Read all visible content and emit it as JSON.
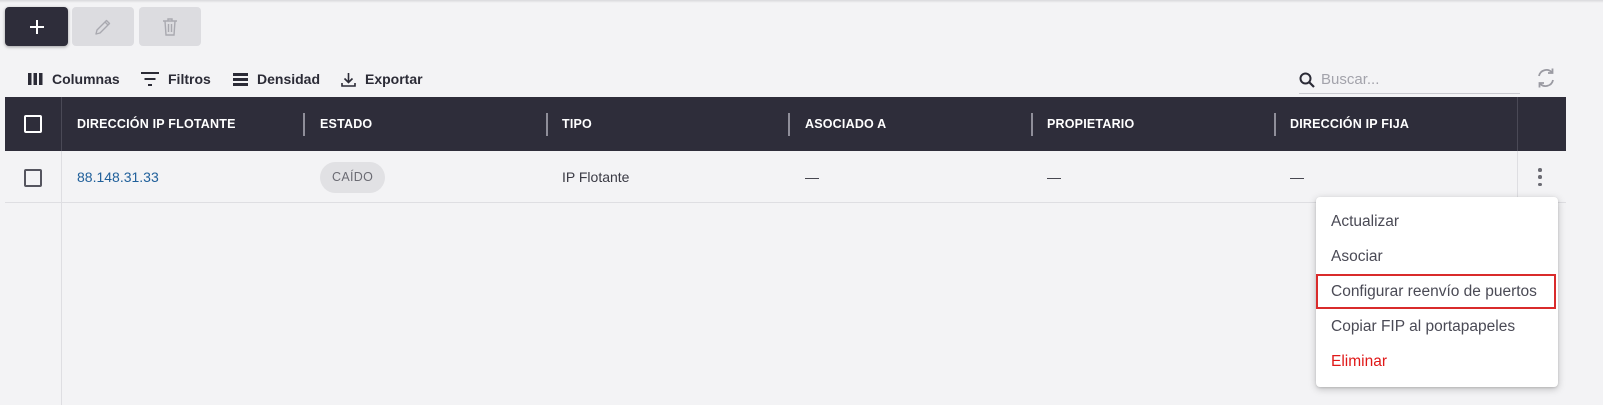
{
  "actions": {
    "add_icon": "plus-icon",
    "edit_icon": "pencil-icon",
    "delete_icon": "trash-icon"
  },
  "toolbar": {
    "columns_label": "Columnas",
    "filters_label": "Filtros",
    "density_label": "Densidad",
    "export_label": "Exportar",
    "search_placeholder": "Buscar...",
    "refresh_icon": "refresh-icon"
  },
  "table": {
    "columns": [
      "DIRECCIÓN IP FLOTANTE",
      "ESTADO",
      "TIPO",
      "ASOCIADO A",
      "PROPIETARIO",
      "DIRECCIÓN IP FIJA"
    ],
    "rows": [
      {
        "ip": "88.148.31.33",
        "status": "CAÍDO",
        "type": "IP Flotante",
        "associated": "—",
        "owner": "—",
        "fixed_ip": "—"
      }
    ]
  },
  "context_menu": {
    "items": [
      "Actualizar",
      "Asociar",
      "Configurar reenvío de puertos",
      "Copiar FIP al portapapeles",
      "Eliminar"
    ],
    "highlighted_index": 2
  },
  "colors": {
    "header_bg": "#2e2d3a",
    "link": "#1f5f9a",
    "danger": "#e01818",
    "highlight_border": "#d92b2b"
  }
}
